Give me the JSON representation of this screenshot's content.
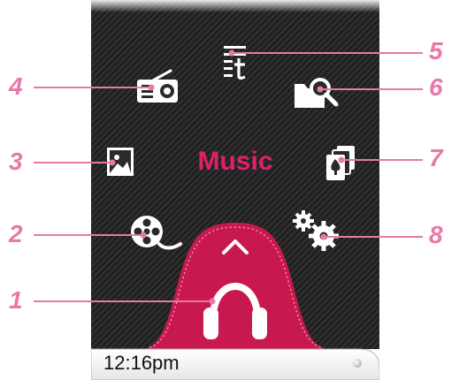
{
  "screen": {
    "title": "Music"
  },
  "status_bar": {
    "time": "12:16pm"
  },
  "colors": {
    "accent": "#c8194f",
    "callout": "#e878a8",
    "side_bar": "#e0101e",
    "title": "#e0206a"
  },
  "menu_items": [
    {
      "number": "1",
      "icon": "headphones-icon",
      "name": "music"
    },
    {
      "number": "2",
      "icon": "film-reel-icon",
      "name": "video"
    },
    {
      "number": "3",
      "icon": "picture-icon",
      "name": "photo"
    },
    {
      "number": "4",
      "icon": "radio-icon",
      "name": "fm-radio"
    },
    {
      "number": "5",
      "icon": "text-icon",
      "name": "text-viewer"
    },
    {
      "number": "6",
      "icon": "folder-search-icon",
      "name": "file-browser"
    },
    {
      "number": "7",
      "icon": "cards-icon",
      "name": "games"
    },
    {
      "number": "8",
      "icon": "gears-icon",
      "name": "settings"
    }
  ]
}
